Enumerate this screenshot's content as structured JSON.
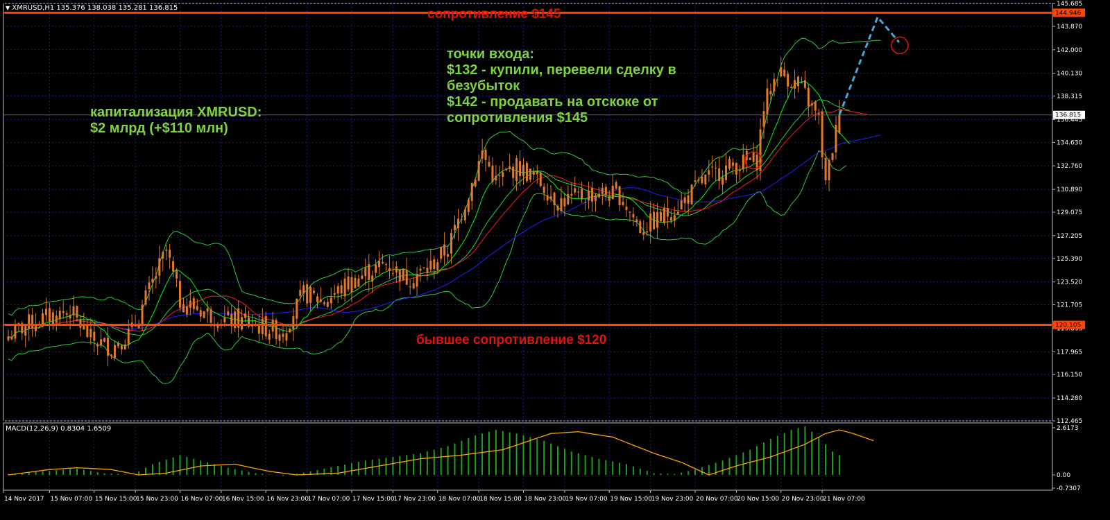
{
  "header": {
    "symbol_line": "XMRUSD,H1  135.376 138.038 135.281 136.815",
    "macd_line": "MACD(12,26,9) 0.8304 1.6509"
  },
  "annotations": {
    "capitalization": "капитализация XMRUSD:\n$2 млрд (+$110 млн)",
    "entries": "точки входа:\n$132 - купили, перевели сделку в\nбезубыток\n$142 - продавать на отскоке от\nсопротивления $145"
  },
  "levels": {
    "resistance": {
      "price": 144.946,
      "label": "сопротивление $145",
      "tag": "144.946"
    },
    "former_resistance": {
      "price": 120.105,
      "label": "бывшее сопротивление $120",
      "tag": "120.105"
    },
    "current": {
      "price": 136.815,
      "tag": "136.815"
    }
  },
  "colors": {
    "candle": "#e07a2e",
    "level_line": "#ff4500",
    "label_red": "#e0140a",
    "grid": "#1c1c8c",
    "bb": "#2ecc40",
    "ma_fast": "#00ff00",
    "ma_mid": "#ff1a1a",
    "ma_slow": "#2020ff",
    "forecast": "#4aa8d8",
    "macd_hist": "#1fa01f",
    "macd_signal": "#ffa500",
    "axis_text": "#ffffff"
  },
  "chart_data": {
    "type": "candlestick",
    "symbol": "XMRUSD",
    "timeframe": "H1",
    "price_axis": {
      "min": 112.465,
      "max": 145.685,
      "ticks": [
        "145.685",
        "143.870",
        "142.000",
        "140.130",
        "138.315",
        "136.445",
        "134.630",
        "132.760",
        "130.890",
        "129.075",
        "127.205",
        "125.390",
        "123.520",
        "121.705",
        "119.835",
        "117.965",
        "116.150",
        "114.280",
        "112.465"
      ]
    },
    "x_ticks": [
      "14 Nov 2017",
      "15 Nov 07:00",
      "15 Nov 15:00",
      "15 Nov 23:00",
      "16 Nov 07:00",
      "16 Nov 15:00",
      "16 Nov 23:00",
      "17 Nov 07:00",
      "17 Nov 15:00",
      "17 Nov 23:00",
      "18 Nov 07:00",
      "18 Nov 15:00",
      "18 Nov 23:00",
      "19 Nov 07:00",
      "19 Nov 15:00",
      "19 Nov 23:00",
      "20 Nov 07:00",
      "20 Nov 15:00",
      "20 Nov 23:00",
      "21 Nov 07:00"
    ],
    "close_anchors": [
      [
        0,
        119.2
      ],
      [
        6,
        120.2
      ],
      [
        12,
        120.8
      ],
      [
        18,
        121.2
      ],
      [
        24,
        119.0
      ],
      [
        30,
        118.3
      ],
      [
        36,
        119.6
      ],
      [
        42,
        123.5
      ],
      [
        46,
        126.0
      ],
      [
        50,
        122.0
      ],
      [
        56,
        121.3
      ],
      [
        62,
        120.5
      ],
      [
        68,
        120.4
      ],
      [
        74,
        119.9
      ],
      [
        80,
        119.6
      ],
      [
        86,
        122.6
      ],
      [
        92,
        122.0
      ],
      [
        98,
        123.2
      ],
      [
        104,
        124.2
      ],
      [
        110,
        125.0
      ],
      [
        116,
        123.8
      ],
      [
        122,
        124.5
      ],
      [
        128,
        126.2
      ],
      [
        134,
        130.6
      ],
      [
        138,
        133.8
      ],
      [
        142,
        131.5
      ],
      [
        148,
        132.7
      ],
      [
        154,
        131.7
      ],
      [
        160,
        129.9
      ],
      [
        166,
        130.3
      ],
      [
        172,
        130.6
      ],
      [
        178,
        130.4
      ],
      [
        184,
        127.8
      ],
      [
        190,
        128.6
      ],
      [
        196,
        129.8
      ],
      [
        202,
        131.5
      ],
      [
        208,
        132.5
      ],
      [
        214,
        133.0
      ],
      [
        218,
        133.2
      ],
      [
        220,
        137.5
      ],
      [
        224,
        140.3
      ],
      [
        228,
        139.6
      ],
      [
        232,
        138.4
      ],
      [
        236,
        136.4
      ],
      [
        238,
        131.2
      ],
      [
        240,
        134.2
      ],
      [
        242,
        136.8
      ]
    ],
    "macd_axis": {
      "max": 2.6173,
      "zero": 0.0,
      "min": -0.7307,
      "ticks": [
        "2.6173",
        "0.00",
        "-0.7307"
      ]
    },
    "macd_hist_anchors": [
      [
        0,
        0.05
      ],
      [
        10,
        0.2
      ],
      [
        20,
        0.35
      ],
      [
        28,
        0.1
      ],
      [
        36,
        0.0
      ],
      [
        42,
        0.6
      ],
      [
        50,
        1.1
      ],
      [
        56,
        0.8
      ],
      [
        64,
        0.4
      ],
      [
        72,
        0.1
      ],
      [
        80,
        -0.05
      ],
      [
        88,
        0.2
      ],
      [
        96,
        0.5
      ],
      [
        104,
        0.8
      ],
      [
        112,
        1.0
      ],
      [
        120,
        1.2
      ],
      [
        128,
        1.6
      ],
      [
        136,
        2.2
      ],
      [
        142,
        2.5
      ],
      [
        148,
        2.3
      ],
      [
        156,
        1.9
      ],
      [
        164,
        1.3
      ],
      [
        172,
        0.9
      ],
      [
        180,
        0.6
      ],
      [
        188,
        0.1
      ],
      [
        194,
        0.05
      ],
      [
        200,
        0.3
      ],
      [
        208,
        0.8
      ],
      [
        216,
        1.4
      ],
      [
        222,
        2.0
      ],
      [
        228,
        2.5
      ],
      [
        232,
        2.7
      ],
      [
        236,
        2.1
      ],
      [
        240,
        1.3
      ],
      [
        242,
        1.1
      ]
    ],
    "macd_signal_anchors": [
      [
        0,
        0.0
      ],
      [
        12,
        0.3
      ],
      [
        20,
        0.4
      ],
      [
        30,
        0.3
      ],
      [
        38,
        0.0
      ],
      [
        46,
        0.1
      ],
      [
        56,
        0.5
      ],
      [
        66,
        0.6
      ],
      [
        76,
        0.2
      ],
      [
        84,
        0.0
      ],
      [
        96,
        0.1
      ],
      [
        108,
        0.5
      ],
      [
        120,
        0.9
      ],
      [
        132,
        1.1
      ],
      [
        144,
        1.4
      ],
      [
        158,
        2.3
      ],
      [
        166,
        2.4
      ],
      [
        176,
        2.1
      ],
      [
        188,
        1.2
      ],
      [
        196,
        0.7
      ],
      [
        204,
        0.0
      ],
      [
        212,
        0.5
      ],
      [
        222,
        1.0
      ],
      [
        232,
        1.7
      ],
      [
        238,
        2.3
      ],
      [
        242,
        2.5
      ],
      [
        246,
        2.3
      ],
      [
        252,
        1.9
      ]
    ]
  }
}
